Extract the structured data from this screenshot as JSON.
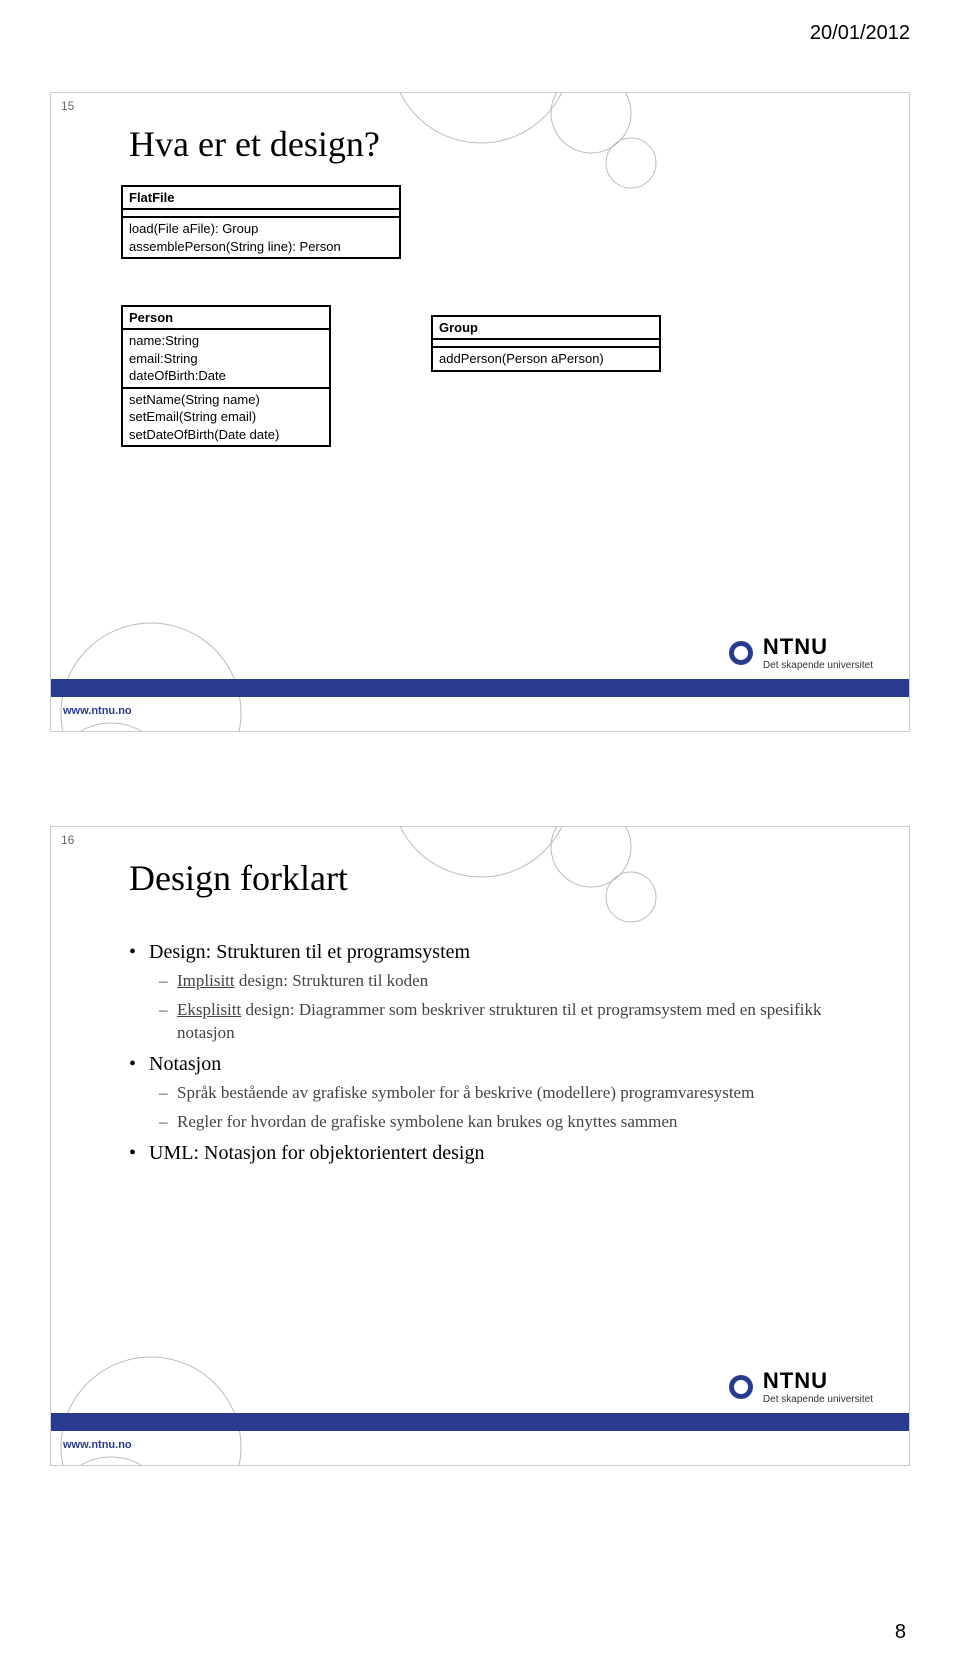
{
  "header_date": "20/01/2012",
  "page_number": "8",
  "slide1": {
    "number": "15",
    "title": "Hva er et design?",
    "uml": {
      "flatfile": {
        "name": "FlatFile",
        "ops": [
          "load(File aFile): Group",
          "assemblePerson(String line): Person"
        ]
      },
      "person": {
        "name": "Person",
        "attrs": [
          "name:String",
          "email:String",
          "dateOfBirth:Date"
        ],
        "ops": [
          "setName(String name)",
          "setEmail(String email)",
          "setDateOfBirth(Date date)"
        ]
      },
      "group": {
        "name": "Group",
        "ops": [
          "addPerson(Person aPerson)"
        ]
      }
    }
  },
  "slide2": {
    "number": "16",
    "title": "Design forklart",
    "bullets": {
      "b1": "Design: Strukturen til et programsystem",
      "b1_1": "Implisitt design: Strukturen til koden",
      "b1_2": "Eksplisitt design: Diagrammer som beskriver strukturen til et programsystem med en spesifikk notasjon",
      "b2": "Notasjon",
      "b2_1": "Språk bestående av grafiske symboler for å beskrive (modellere) programvaresystem",
      "b2_2": "Regler for hvordan de grafiske symbolene kan brukes og knyttes sammen",
      "b3": "UML: Notasjon for objektorientert design"
    }
  },
  "logo": {
    "name": "NTNU",
    "tagline": "Det skapende universitet"
  },
  "footer_url": "www.ntnu.no"
}
